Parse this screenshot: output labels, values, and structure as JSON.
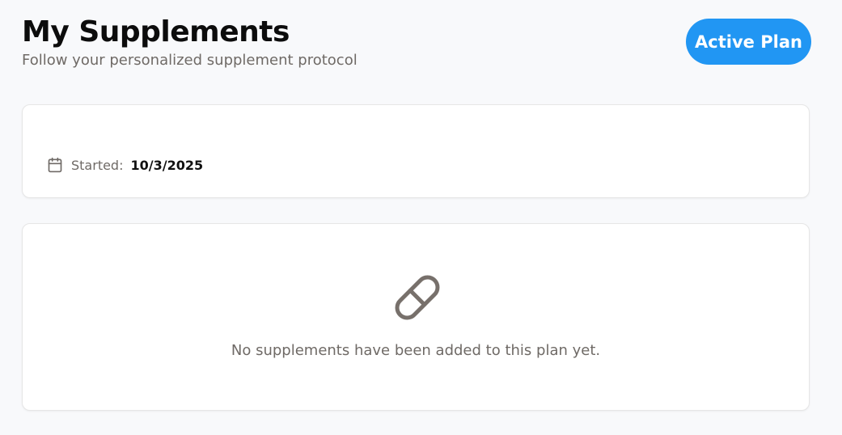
{
  "header": {
    "title": "My Supplements",
    "subtitle": "Follow your personalized supplement protocol",
    "badge_label": "Active Plan"
  },
  "plan": {
    "started_label": "Started:",
    "started_date": "10/3/2025",
    "icon": "calendar-icon"
  },
  "supplements": {
    "icon": "pill-icon",
    "empty_message": "No supplements have been added to this plan yet."
  },
  "colors": {
    "accent": "#2196f3",
    "background": "#f8f9fb",
    "muted_text": "#6f6a66",
    "card_border": "#e6e6e6"
  }
}
